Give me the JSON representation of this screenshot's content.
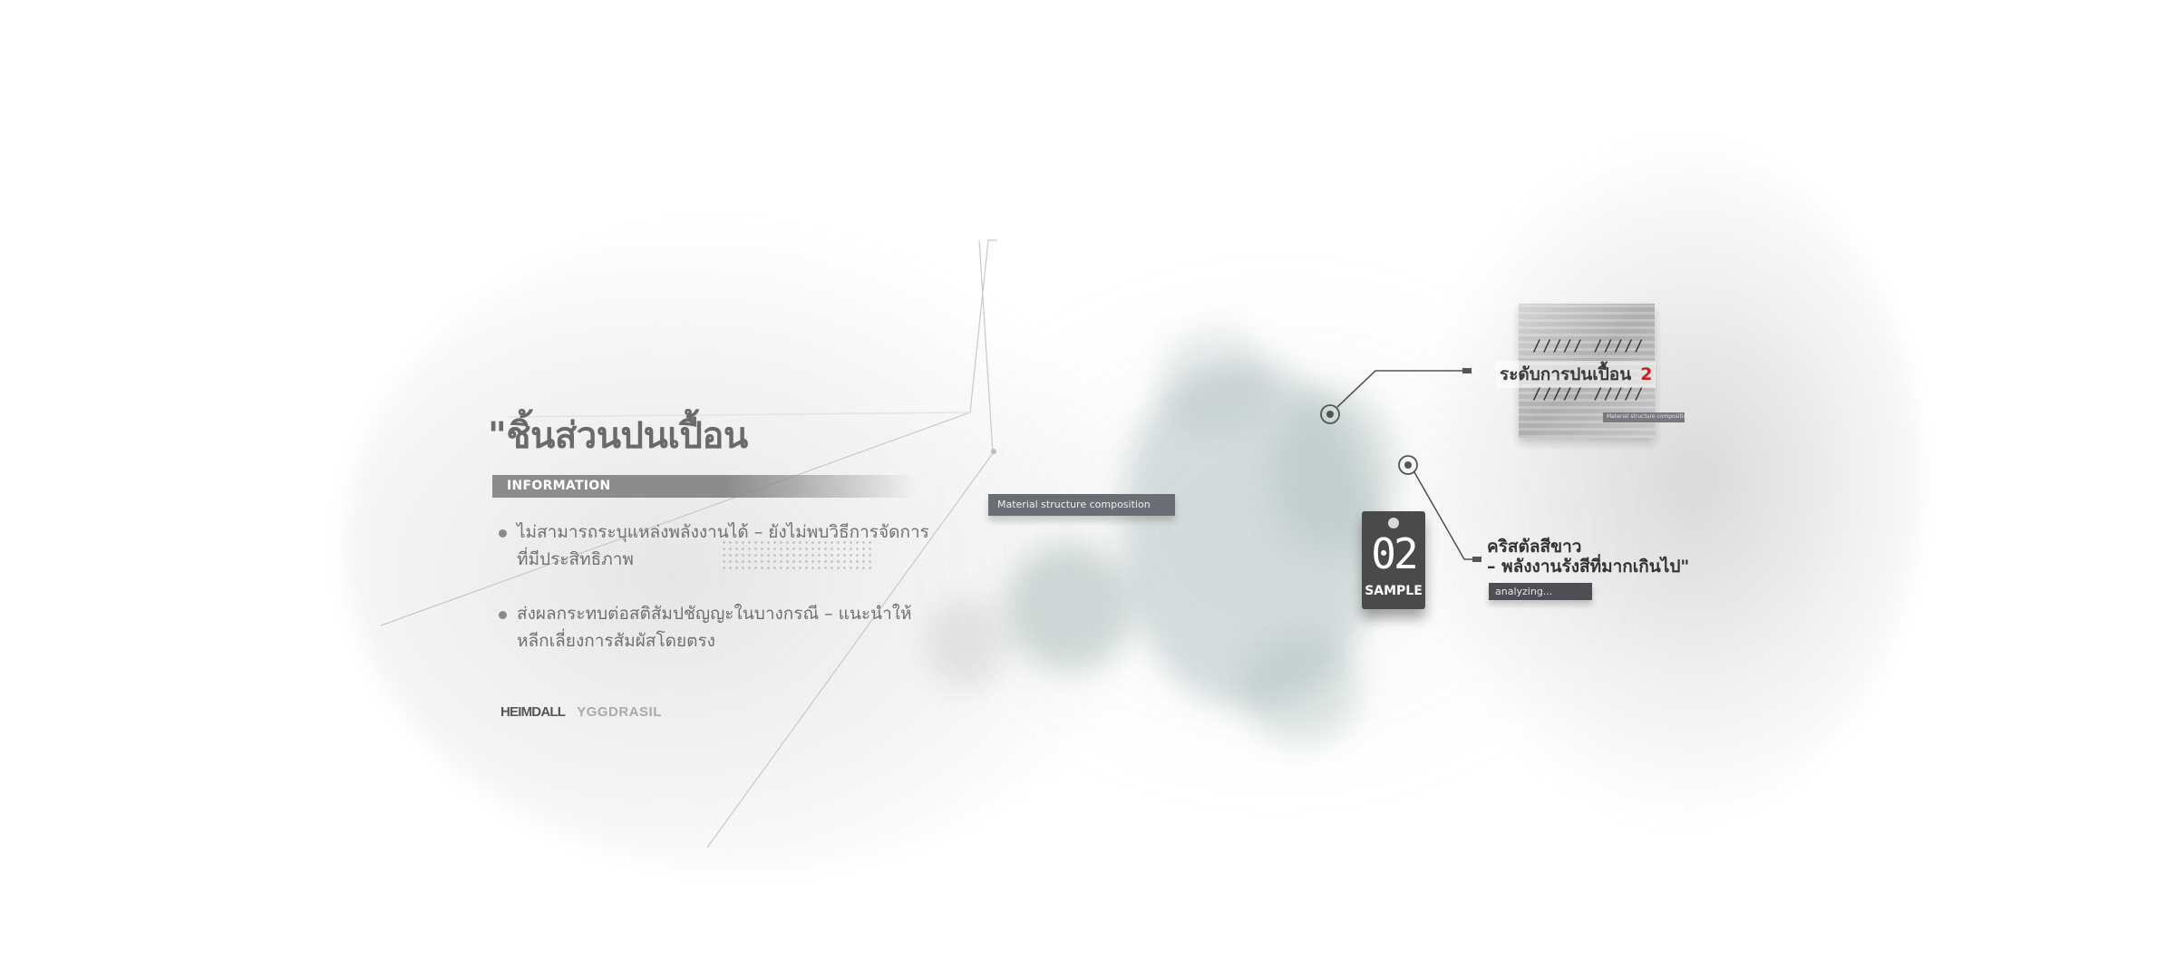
{
  "title": "\"ชิ้นส่วนปนเปื้อน",
  "info_label": "INFORMATION",
  "bullets": [
    {
      "line1": "ไม่สามารถระบุแหล่งพลังงานได้ – ยังไม่พบวิธีการจัดการ",
      "line2": "ที่มีประสิทธิภาพ"
    },
    {
      "line1": "ส่งผลกระทบต่อสติสัมปชัญญะในบางกรณี – แนะนำให้",
      "line2": "หลีกเลี่ยงการสัมผัสโดยตรง"
    }
  ],
  "logos": {
    "brand1": "HEIMDALL",
    "brand2": "YGGDRASIL"
  },
  "material_tag": "Material structure composition",
  "sample": {
    "number": "02",
    "label": "SAMPLE"
  },
  "contamination": {
    "label": "ระดับการปนเปื้อน",
    "value": "2",
    "slashes_top": "///// /////",
    "slashes_bottom": "///// /////",
    "thumb_caption": "Material structure composition"
  },
  "crystal": {
    "line1": "คริสตัลสีขาว",
    "line2": "– พลังงานรังสีที่มากเกินไป\"",
    "status": "analyzing..."
  },
  "colors": {
    "accent_red": "#cc1f1f",
    "tag_dark": "#4a4a4a",
    "bar_grey": "#8c8c8c"
  }
}
